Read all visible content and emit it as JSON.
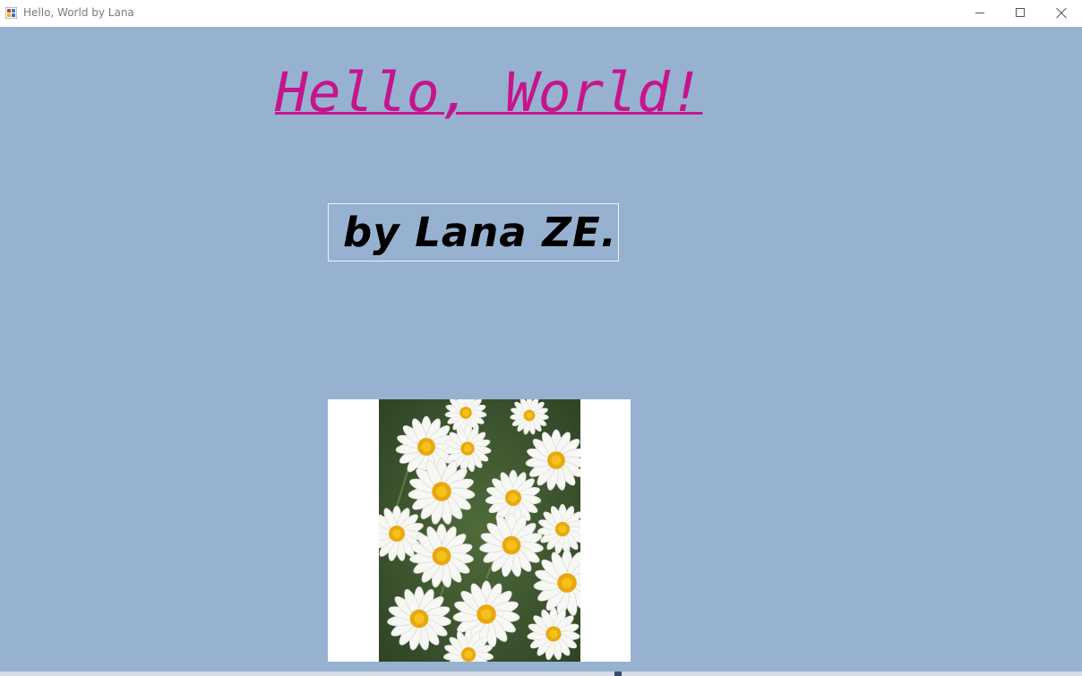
{
  "window": {
    "title": "Hello, World by Lana",
    "app_icon": "winforms-app-icon",
    "background_color": "#97b2d1",
    "controls": {
      "minimize": "minimize-icon",
      "maximize": "maximize-icon",
      "close": "close-icon"
    }
  },
  "main": {
    "heading": "Hello, World!",
    "heading_color": "#c5158d",
    "byline": "by Lana ZE."
  },
  "picture": {
    "subject": "white daisies with yellow centers",
    "icon": "daisy-photo"
  }
}
